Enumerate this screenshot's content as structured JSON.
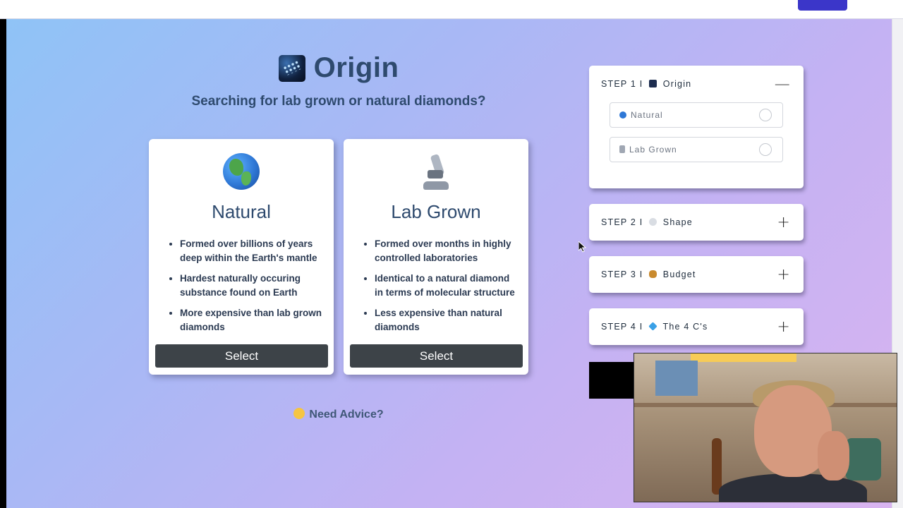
{
  "heading": {
    "title": "Origin",
    "subtitle": "Searching for lab grown or natural diamonds?"
  },
  "cards": [
    {
      "title": "Natural",
      "icon": "globe-americas-icon",
      "points": [
        "Formed over billions of years deep within the Earth's mantle",
        "Hardest naturally occuring substance found on Earth",
        "More expensive than lab grown diamonds"
      ],
      "button": "Select"
    },
    {
      "title": "Lab Grown",
      "icon": "microscope-icon",
      "points": [
        "Formed over months in highly controlled laboratories",
        "Identical to a natural diamond in terms of molecular structure",
        "Less expensive than natural diamonds"
      ],
      "button": "Select"
    }
  ],
  "advice": {
    "label": "Need Advice?"
  },
  "steps": [
    {
      "prefix": "STEP 1 I",
      "name": "Origin",
      "toggle": "—",
      "expanded": true,
      "options": [
        {
          "label": "Natural"
        },
        {
          "label": "Lab Grown"
        }
      ]
    },
    {
      "prefix": "STEP 2 I",
      "name": "Shape",
      "toggle": "+",
      "expanded": false
    },
    {
      "prefix": "STEP 3 I",
      "name": "Budget",
      "toggle": "+",
      "expanded": false
    },
    {
      "prefix": "STEP 4 I",
      "name": "The 4 C's",
      "toggle": "+",
      "expanded": false
    }
  ],
  "colors": {
    "title": "#2e4a6e",
    "button": "#3d4348",
    "accent": "#3b36c9"
  }
}
